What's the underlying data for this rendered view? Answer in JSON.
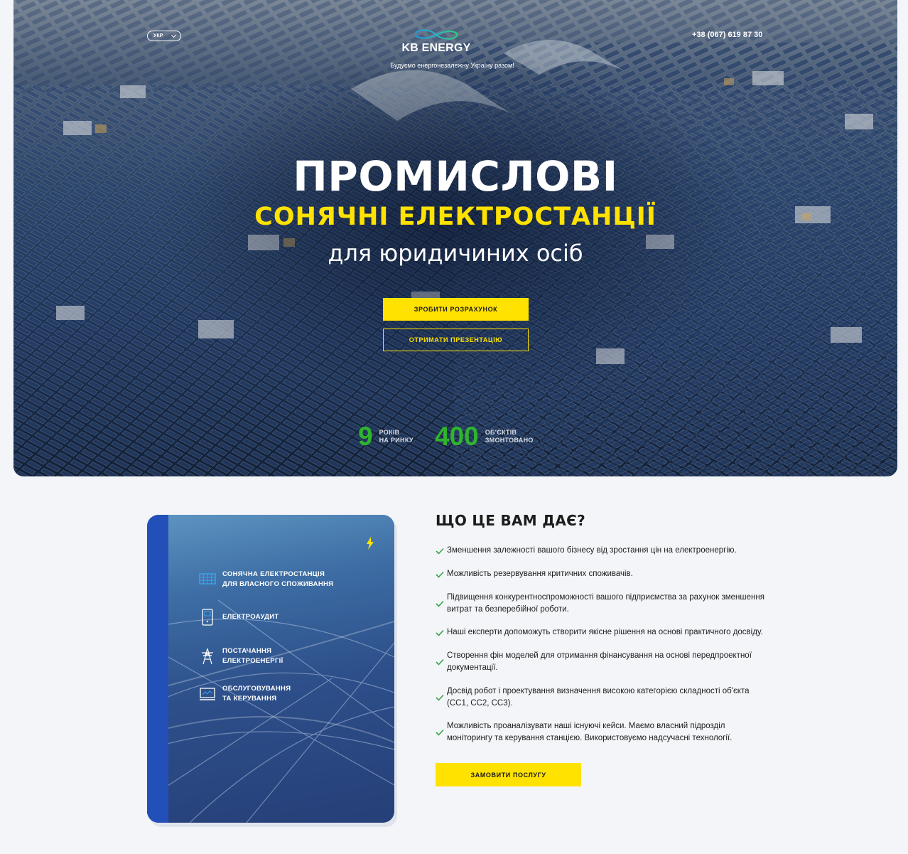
{
  "header": {
    "language": "УКР",
    "brand": "KB ENERGY",
    "tagline": "Будуємо енергонезалежну Україну разом!",
    "phone": "+38 (067) 619 87 30"
  },
  "hero": {
    "title": "ПРОМИСЛОВІ",
    "subtitle": "СОНЯЧНІ ЕЛЕКТРОСТАНЦІЇ",
    "subtitle2": "для юридичиних осіб",
    "primary_button": "ЗРОБИТИ РОЗРАХУНОК",
    "secondary_button": "ОТРИМАТИ ПРЕЗЕНТАЦІЮ",
    "stats": [
      {
        "value": "9",
        "label_line1": "РОКІВ",
        "label_line2": "НА РИНКУ"
      },
      {
        "value": "400",
        "label_line1": "ОБ'ЄКТІВ",
        "label_line2": "ЗМОНТОВАНО"
      }
    ]
  },
  "services": {
    "items": [
      {
        "icon": "solar-panel-icon",
        "line1": "СОНЯЧНА ЕЛЕКТРОСТАНЦІЯ",
        "line2": "ДЛЯ ВЛАСНОГО СПОЖИВАННЯ"
      },
      {
        "icon": "meter-icon",
        "line1": "ЕЛЕКТРОАУДИТ",
        "line2": ""
      },
      {
        "icon": "power-tower-icon",
        "line1": "ПОСТАЧАННЯ",
        "line2": "ЕЛЕКТРОЕНЕРГІЇ"
      },
      {
        "icon": "monitor-icon",
        "line1": "ОБСЛУГОВУВАННЯ",
        "line2": "ТА КЕРУВАННЯ"
      }
    ]
  },
  "benefits": {
    "title": "ЩО ЦЕ ВАМ ДАЄ?",
    "items": [
      "Зменшення залежності вашого бізнесу від зростання цін на електроенергію.",
      "Можливість резервування критичних споживачів.",
      "Підвищення конкурентноспроможності вашого підприємства за рахунок зменшення витрат та безперебійної роботи.",
      "Наші експерти допоможуть створити якісне рішення на основі практичного досвіду.",
      "Створення фін моделей для отримання фінансування на основі передпроектної документації.",
      "Досвід робот і проектування визначення високою категорією складності об'єкта (СС1, СС2, СС3).",
      "Можливість проаналізувати наші існуючі кейси. Маємо власний підрозділ моніторингу та керування станцією. Використовуємо надсучасні технології."
    ],
    "cta": "ЗАМОВИТИ ПОСЛУГУ"
  },
  "colors": {
    "accent_yellow": "#ffe200",
    "stat_green": "#2fb52c",
    "check_green": "#3aa34a",
    "card_stripe": "#2350b8"
  }
}
